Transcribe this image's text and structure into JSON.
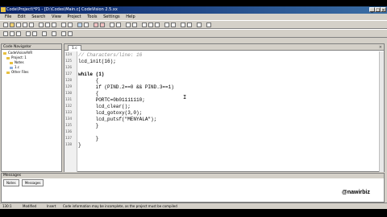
{
  "window": {
    "title": "Code\\Project\\*P1 - [D:\\Codes\\Main.c] CodeVision 2.5.xx",
    "controls": [
      "_",
      "□",
      "×"
    ]
  },
  "menu": [
    "File",
    "Edit",
    "Search",
    "View",
    "Project",
    "Tools",
    "Settings",
    "Help"
  ],
  "navigator": {
    "title": "Code Navigator",
    "items": [
      "CodeVisionAVR",
      "Project: 1",
      "Notes",
      "1.c",
      "Other Files"
    ]
  },
  "editor": {
    "tab_label": "1.c",
    "close_label": "×",
    "lines": [
      {
        "num": "124",
        "text": "// Characters/line: 16"
      },
      {
        "num": "125",
        "text": "lcd_init(16);"
      },
      {
        "num": "126",
        "text": ""
      },
      {
        "num": "127",
        "text": "while (1)"
      },
      {
        "num": "128",
        "text": "      {"
      },
      {
        "num": "129",
        "text": "      if (PIND.2==0 && PIND.3==1)"
      },
      {
        "num": "130",
        "text": "      {"
      },
      {
        "num": "131",
        "text": "      PORTC=0b01111110;"
      },
      {
        "num": "132",
        "text": "      lcd_clear();"
      },
      {
        "num": "133",
        "text": "      lcd_gotoxy(3,0);"
      },
      {
        "num": "134",
        "text": "      lcd_putsf(\"MENYALA\");"
      },
      {
        "num": "135",
        "text": "      }"
      },
      {
        "num": "136",
        "text": ""
      },
      {
        "num": "137",
        "text": "      }"
      },
      {
        "num": "138",
        "text": "}"
      }
    ],
    "cursor_glyph": "I"
  },
  "messages": {
    "title": "Messages",
    "tabs": [
      "Notes",
      "Messages"
    ]
  },
  "watermark": "@nawirbiz",
  "status": {
    "position": "130:1",
    "mode": "Modified",
    "insert": "Insert",
    "hint": "Code information may be incomplete, as the project must be compiled"
  }
}
